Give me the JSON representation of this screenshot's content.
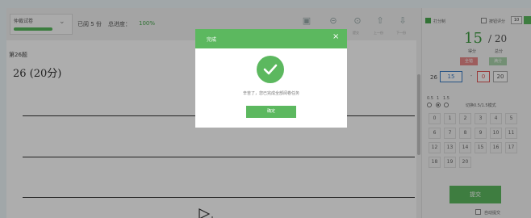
{
  "header": {
    "select_label": "仲裁试卷",
    "done_text": "已阅 5 份",
    "progress_label": "总进度：",
    "progress_value": "100%",
    "toolbar": [
      "提交",
      "上一份",
      "下一份"
    ]
  },
  "question": {
    "number_label": "第26题",
    "title": "26 (20分)"
  },
  "side": {
    "score_mode_label": "打分制",
    "auto_submit_label": "按钮评分",
    "auto_submit_value": "10",
    "score": "15",
    "total": "/ 20",
    "score_caption": "得分",
    "total_caption": "总分",
    "zero_label": "全错",
    "full_label": "满分",
    "q_index": "26",
    "input_value": "15",
    "min_value": "0",
    "max_value": "20",
    "step_labels": [
      "0.5",
      "1",
      "1.5"
    ],
    "step_hint": "切换0.5/1.5模式",
    "keys": [
      "0",
      "1",
      "2",
      "3",
      "4",
      "5",
      "6",
      "7",
      "8",
      "9",
      "10",
      "11",
      "12",
      "13",
      "14",
      "15",
      "16",
      "17",
      "18",
      "19",
      "20"
    ],
    "submit_label": "提交",
    "auto_label": "自动提交"
  },
  "modal": {
    "title": "完成",
    "message": "辛苦了，您已完成全部阅卷任务",
    "ok_label": "确定"
  },
  "colors": {
    "accent": "#5cb85f",
    "score_green": "#3a9a3e",
    "danger": "#e05555"
  }
}
